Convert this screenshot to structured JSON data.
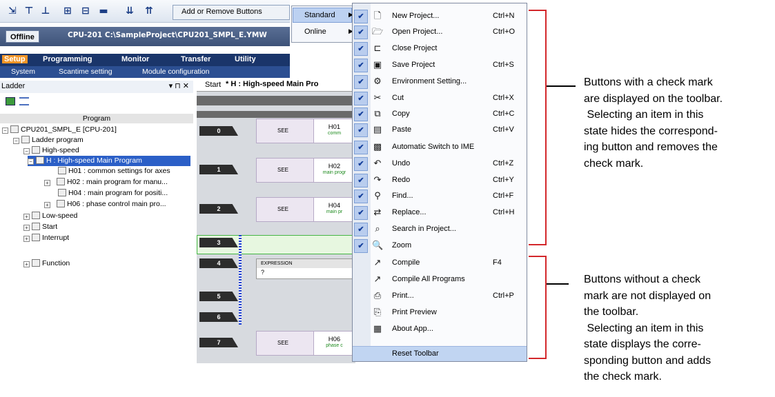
{
  "toolbar": {
    "add_remove_label": "Add or Remove Buttons"
  },
  "pathbar": {
    "status": "Offline",
    "cpu_path": "CPU-201   C:\\SampleProject\\CPU201_SMPL_E.YMW"
  },
  "main_tabs": [
    "Setup",
    "Programming",
    "Monitor",
    "Transfer",
    "Utility"
  ],
  "sub_tabs": [
    "System",
    "Scantime setting",
    "Module configuration"
  ],
  "panel": {
    "title": "Ladder",
    "controls": "▾ ⊓ ✕",
    "program_header": "Program",
    "tree": [
      "CPU201_SMPL_E [CPU-201]",
      "Ladder program",
      "High-speed",
      "H : High-speed Main Program",
      "H01 : common settings for axes",
      "H02 : main program for manu...",
      "H04 : main program for positi...",
      "H06 : phase control main pro...",
      "Low-speed",
      "Start",
      "Interrupt",
      "Function"
    ]
  },
  "document": {
    "tab_start": "Start",
    "tab_active": "* H : High-speed Main Pro",
    "rows": [
      "0",
      "1",
      "2",
      "3",
      "4",
      "5",
      "6",
      "7"
    ],
    "see": "SEE",
    "blocks": [
      {
        "name": "H01",
        "sub": "comm"
      },
      {
        "name": "H02",
        "sub": "main progr"
      },
      {
        "name": "H04",
        "sub": "main pr"
      },
      {
        "name": "H06",
        "sub": "phase c"
      }
    ],
    "expression_label": "EXPRESSION",
    "expression_value": "?"
  },
  "menu1": {
    "items": [
      "Standard",
      "Online"
    ]
  },
  "menu2": {
    "items": [
      {
        "icon": "new-project-icon",
        "glyph": "🗋",
        "label": "New Project...",
        "shortcut": "Ctrl+N",
        "checked": true
      },
      {
        "icon": "open-project-icon",
        "glyph": "🗁",
        "label": "Open Project...",
        "shortcut": "Ctrl+O",
        "checked": true
      },
      {
        "icon": "close-project-icon",
        "glyph": "⊏",
        "label": "Close Project",
        "shortcut": "",
        "checked": true
      },
      {
        "icon": "save-project-icon",
        "glyph": "▣",
        "label": "Save Project",
        "shortcut": "Ctrl+S",
        "checked": true
      },
      {
        "icon": "environment-setting-icon",
        "glyph": "⚙",
        "label": "Environment Setting...",
        "shortcut": "",
        "checked": true
      },
      {
        "icon": "cut-icon",
        "glyph": "✂",
        "label": "Cut",
        "shortcut": "Ctrl+X",
        "checked": true
      },
      {
        "icon": "copy-icon",
        "glyph": "⧉",
        "label": "Copy",
        "shortcut": "Ctrl+C",
        "checked": true
      },
      {
        "icon": "paste-icon",
        "glyph": "▤",
        "label": "Paste",
        "shortcut": "Ctrl+V",
        "checked": true
      },
      {
        "icon": "ime-icon",
        "glyph": "▩",
        "label": "Automatic Switch to IME",
        "shortcut": "",
        "checked": true
      },
      {
        "icon": "undo-icon",
        "glyph": "↶",
        "label": "Undo",
        "shortcut": "Ctrl+Z",
        "checked": true
      },
      {
        "icon": "redo-icon",
        "glyph": "↷",
        "label": "Redo",
        "shortcut": "Ctrl+Y",
        "checked": true
      },
      {
        "icon": "find-icon",
        "glyph": "⚲",
        "label": "Find...",
        "shortcut": "Ctrl+F",
        "checked": true
      },
      {
        "icon": "replace-icon",
        "glyph": "⇄",
        "label": "Replace...",
        "shortcut": "Ctrl+H",
        "checked": true
      },
      {
        "icon": "search-project-icon",
        "glyph": "⌕",
        "label": "Search in Project...",
        "shortcut": "",
        "checked": true
      },
      {
        "icon": "zoom-icon",
        "glyph": "🔍",
        "label": "Zoom",
        "shortcut": "",
        "checked": true
      },
      {
        "icon": "compile-icon",
        "glyph": "↗",
        "label": "Compile",
        "shortcut": "F4",
        "checked": false
      },
      {
        "icon": "compile-all-icon",
        "glyph": "↗",
        "label": "Compile All Programs",
        "shortcut": "",
        "checked": false
      },
      {
        "icon": "print-icon",
        "glyph": "⎙",
        "label": "Print...",
        "shortcut": "Ctrl+P",
        "checked": false
      },
      {
        "icon": "print-preview-icon",
        "glyph": "⎘",
        "label": "Print Preview",
        "shortcut": "",
        "checked": false
      },
      {
        "icon": "about-app-icon",
        "glyph": "▦",
        "label": "About App...",
        "shortcut": "",
        "checked": false
      }
    ],
    "reset": "Reset Toolbar"
  },
  "notes": {
    "checked_lines": [
      "Buttons with a check mark",
      "are displayed on the toolbar.",
      " Selecting an item in this",
      "state hides the correspond-",
      "ing button and removes the",
      "check mark."
    ],
    "unchecked_lines": [
      "Buttons without a check",
      "mark are not displayed on",
      "the toolbar.",
      " Selecting an item in this",
      "state displays the corre-",
      "sponding button and adds",
      "the check mark."
    ]
  },
  "colors": {
    "accent_tab": "#f29526",
    "selection": "#2b5fc7",
    "bracket": "#d3272b"
  }
}
